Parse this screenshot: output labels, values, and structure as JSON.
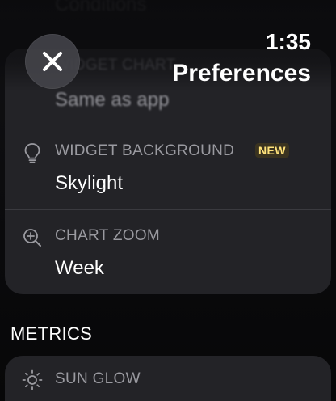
{
  "status": {
    "time": "1:35"
  },
  "header": {
    "title": "Preferences"
  },
  "background_text": {
    "conditions": "Conditions",
    "widget_chart_label": "WIDGET CHART"
  },
  "settings": {
    "items": [
      {
        "icon": "hidden-icon",
        "label": "WIDGET CHART",
        "value": "Same as app"
      },
      {
        "icon": "lightbulb-icon",
        "label": "WIDGET BACKGROUND",
        "badge": "NEW",
        "value": "Skylight"
      },
      {
        "icon": "zoom-in-icon",
        "label": "CHART ZOOM",
        "value": "Week"
      }
    ]
  },
  "metrics": {
    "section_title": "METRICS",
    "items": [
      {
        "icon": "sun-icon",
        "label": "SUN GLOW"
      }
    ]
  },
  "colors": {
    "card_bg": "#232327",
    "label_gray": "#9a9aa0",
    "badge_yellow": "#ffe27a",
    "divider": "#3a3a3f"
  }
}
